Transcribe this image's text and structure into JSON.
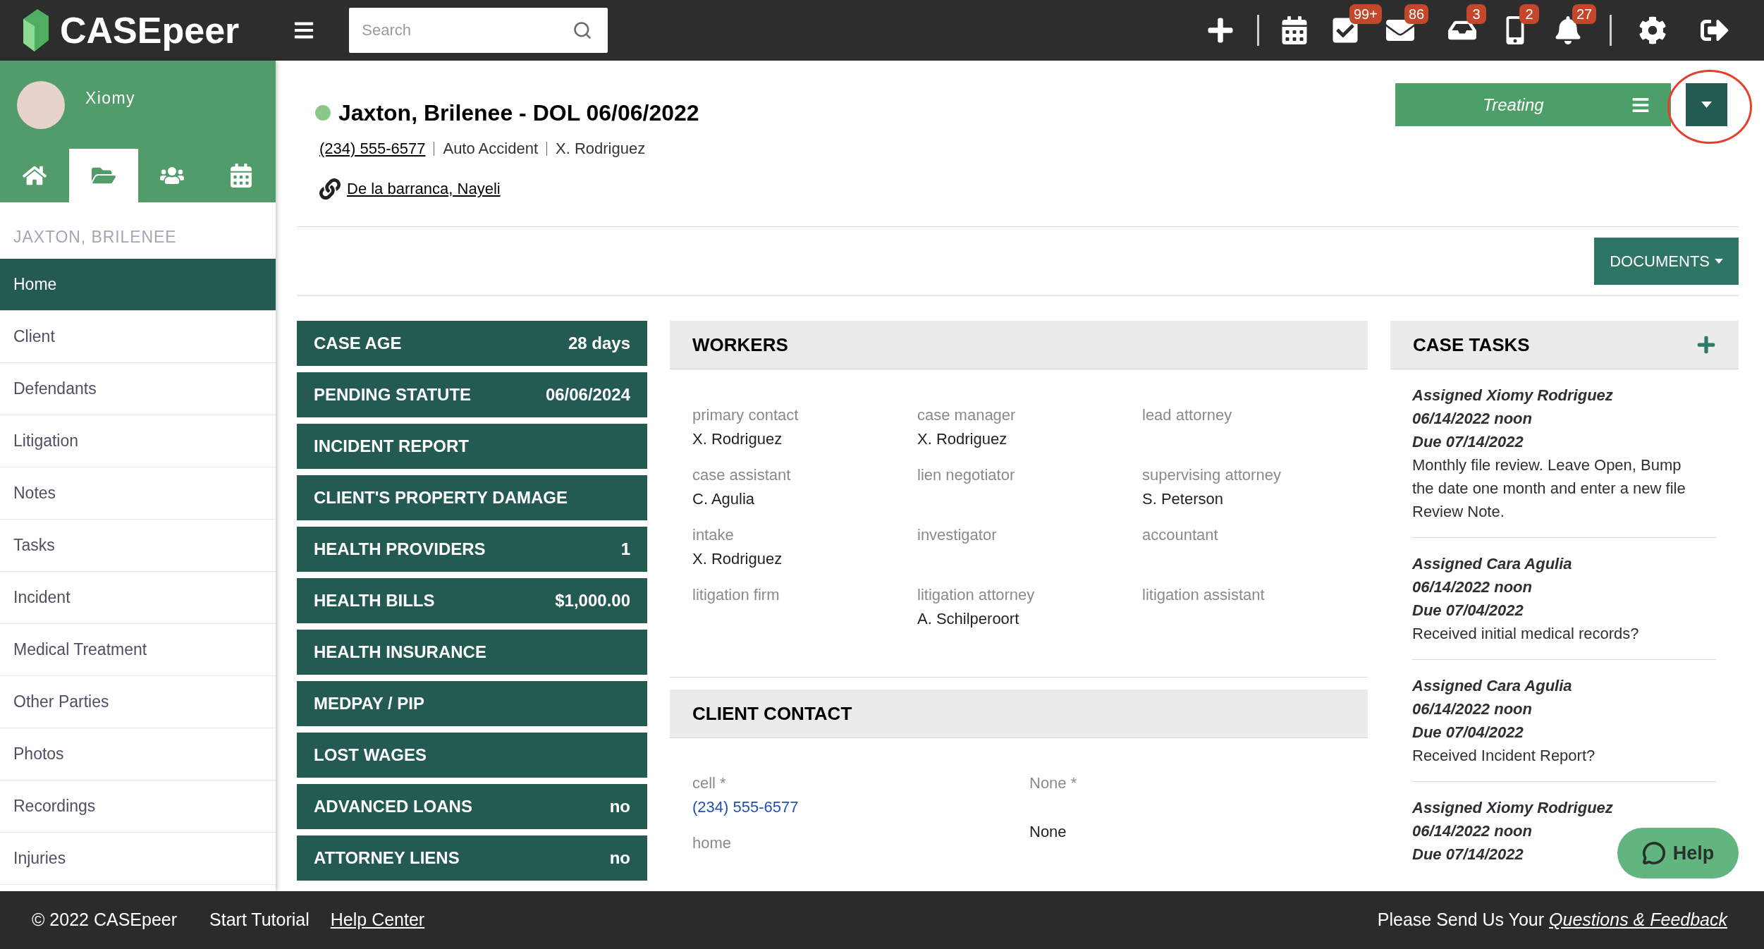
{
  "top_bar": {
    "logo": "CASEpeer",
    "search": {
      "placeholder": "Search"
    },
    "badges": {
      "tasks": "99+",
      "messages": "86",
      "inbox": "3",
      "texts": "2",
      "notifications": "27"
    }
  },
  "sidebar": {
    "user_name": "Xiomy",
    "tabs": [
      {
        "selected": false
      },
      {
        "selected": true
      },
      {
        "selected": false
      },
      {
        "selected": false
      }
    ],
    "case_label": "JAXTON, BRILENEE",
    "items": [
      {
        "label": "Home",
        "selected": true
      },
      {
        "label": "Client",
        "selected": false
      },
      {
        "label": "Defendants",
        "selected": false
      },
      {
        "label": "Litigation",
        "selected": false
      },
      {
        "label": "Notes",
        "selected": false
      },
      {
        "label": "Tasks",
        "selected": false
      },
      {
        "label": "Incident",
        "selected": false
      },
      {
        "label": "Medical Treatment",
        "selected": false
      },
      {
        "label": "Other Parties",
        "selected": false
      },
      {
        "label": "Photos",
        "selected": false
      },
      {
        "label": "Recordings",
        "selected": false
      },
      {
        "label": "Injuries",
        "selected": false
      }
    ]
  },
  "case": {
    "title": "Jaxton, Brilenee - DOL 06/06/2022",
    "phone": "(234) 555-6577",
    "case_type": "Auto Accident",
    "staff": "X. Rodriguez",
    "related_contact": "De la barranca, Nayeli",
    "status_button": "Treating",
    "documents_button": "DOCUMENTS"
  },
  "stats": [
    {
      "label": "CASE AGE",
      "value": "28 days"
    },
    {
      "label": "PENDING STATUTE",
      "value": "06/06/2024"
    },
    {
      "label": "INCIDENT REPORT"
    },
    {
      "label": "CLIENT'S PROPERTY DAMAGE"
    },
    {
      "label": "HEALTH PROVIDERS",
      "value": "1"
    },
    {
      "label": "HEALTH BILLS",
      "value": "$1,000.00"
    },
    {
      "label": "HEALTH INSURANCE"
    },
    {
      "label": "MEDPAY / PIP"
    },
    {
      "label": "LOST WAGES"
    },
    {
      "label": "ADVANCED LOANS",
      "value": "no"
    },
    {
      "label": "ATTORNEY LIENS",
      "value": "no"
    }
  ],
  "workers": {
    "title": "WORKERS",
    "fields": [
      {
        "label": "primary contact",
        "value": "X. Rodriguez"
      },
      {
        "label": "case manager",
        "value": "X. Rodriguez"
      },
      {
        "label": "lead attorney"
      },
      {
        "label": "case assistant",
        "value": "C. Agulia"
      },
      {
        "label": "lien negotiator"
      },
      {
        "label": "supervising attorney",
        "value": "S. Peterson"
      },
      {
        "label": "intake",
        "value": "X. Rodriguez"
      },
      {
        "label": "investigator"
      },
      {
        "label": "accountant"
      },
      {
        "label": "litigation firm"
      },
      {
        "label": "litigation attorney",
        "value": "A. Schilperoort"
      },
      {
        "label": "litigation assistant"
      }
    ]
  },
  "client_contact": {
    "title": "CLIENT CONTACT",
    "columns": [
      {
        "entries": [
          {
            "kind": "label",
            "text": "cell *"
          },
          {
            "kind": "phone",
            "text": "(234) 555-6577"
          },
          {
            "kind": "label",
            "text": "home"
          }
        ]
      },
      {
        "entries": [
          {
            "kind": "label",
            "text": "None *"
          },
          {
            "kind": "value",
            "text": "None"
          }
        ]
      }
    ]
  },
  "case_tasks": {
    "title": "CASE TASKS",
    "items": [
      {
        "assigned": "Assigned Xiomy Rodriguez",
        "created": "06/14/2022 noon",
        "due": "Due 07/14/2022",
        "description": "Monthly file review. Leave Open, Bump the date one month and enter a new file Review Note."
      },
      {
        "assigned": "Assigned Cara Agulia",
        "created": "06/14/2022 noon",
        "due": "Due 07/04/2022",
        "description": "Received initial medical records?"
      },
      {
        "assigned": "Assigned Cara Agulia",
        "created": "06/14/2022 noon",
        "due": "Due 07/04/2022",
        "description": "Received Incident Report?"
      },
      {
        "assigned": "Assigned Xiomy Rodriguez",
        "created": "06/14/2022 noon",
        "due": "Due 07/14/2022"
      }
    ]
  },
  "help_button": "Help",
  "footer": {
    "copyright": "© 2022 CASEpeer",
    "tutorial": "Start Tutorial",
    "help_center": "Help Center",
    "feedback_prompt": "Please Send Us Your",
    "feedback_link": "Questions & Feedback"
  }
}
